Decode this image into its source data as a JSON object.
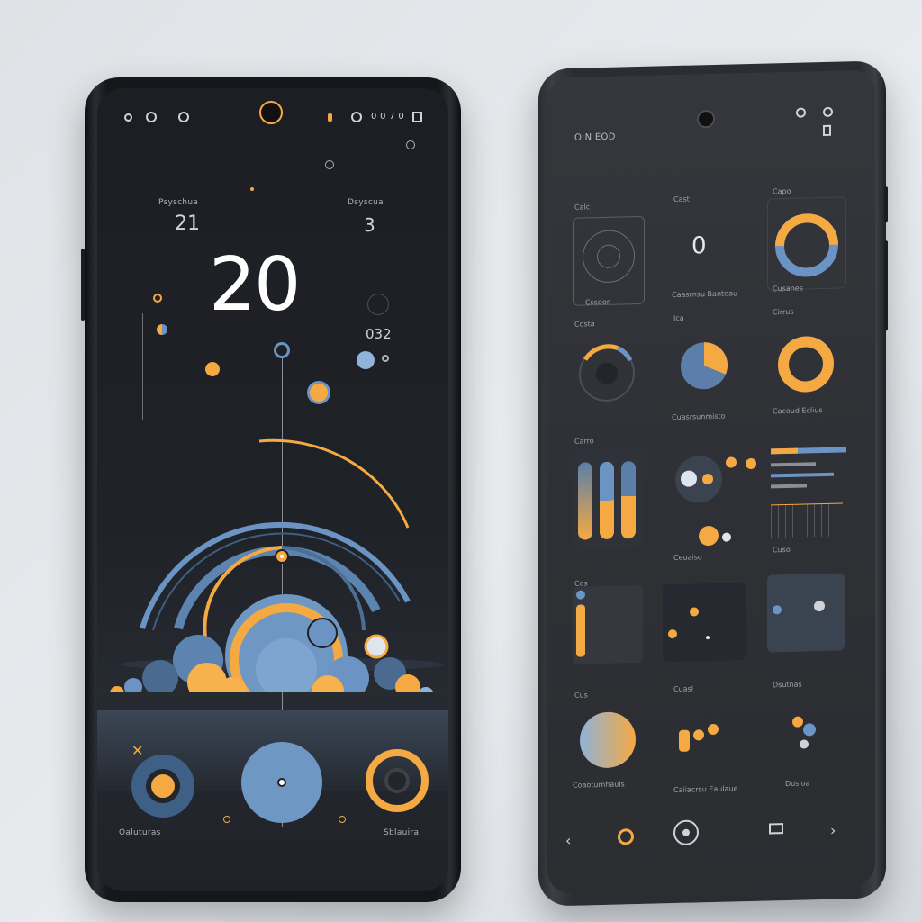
{
  "left_phone": {
    "time": "20",
    "left_label": "Psyschua",
    "left_number": "21",
    "right_label": "Dsyscua",
    "right_number": "3",
    "side_value": "032",
    "bottom_left_label": "Oaluturas",
    "bottom_right_label": "Sblauira",
    "bottom_buttons": [
      "target-icon",
      "circle-button",
      "ring-icon"
    ],
    "colors": {
      "accent": "#f5a942",
      "secondary": "#6b94c4",
      "background": "#1d1f24"
    }
  },
  "right_phone": {
    "status_text": "O:N EOD",
    "rows": [
      {
        "labels": [
          "Cssoon",
          "Caasrnsu Banteau",
          "Cusanes"
        ],
        "top_labels": [
          "Calc",
          "Cast",
          "Capo"
        ],
        "center_value": "0"
      },
      {
        "labels": [
          "",
          "Cuasrsunmisto",
          "Cacoud Eclius"
        ],
        "top_labels": [
          "Costa",
          "Ica",
          "Cirrus"
        ]
      },
      {
        "labels": [
          "",
          "Ceuaiso",
          "Cuso"
        ],
        "top_labels": [
          "Carro",
          "",
          ""
        ]
      },
      {
        "labels": [
          "",
          "",
          ""
        ],
        "top_labels": [
          "Cos",
          "",
          ""
        ]
      },
      {
        "labels": [
          "Coaotumhauis",
          "Caiiacrsu Eaulaue",
          "Dusloa"
        ],
        "top_labels": [
          "Cus",
          "Cuasl",
          "Dsutnas"
        ]
      }
    ],
    "nav": [
      "back-icon",
      "accent-ring-icon",
      "home-ring-icon",
      "apps-icon",
      "forward-icon"
    ],
    "colors": {
      "accent": "#f5a942",
      "secondary": "#6b94c4"
    }
  }
}
